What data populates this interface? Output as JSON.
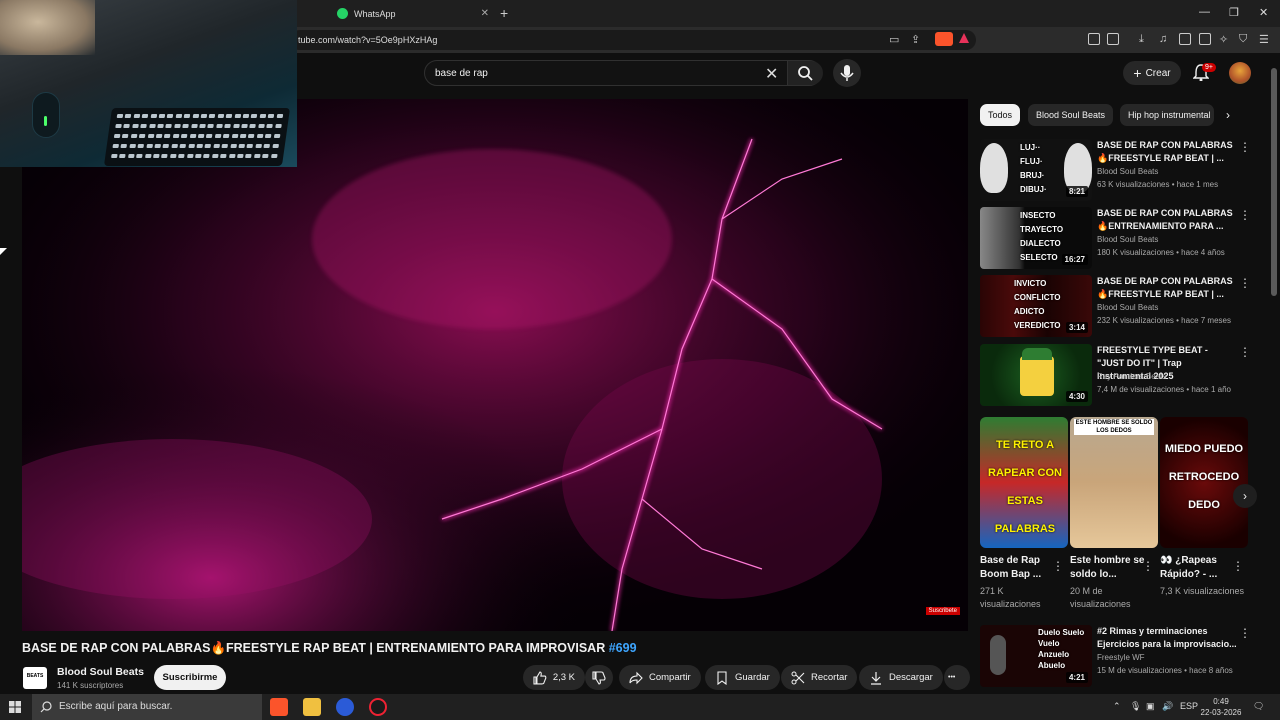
{
  "browser": {
    "tab_label": "WhatsApp",
    "url": "tube.com/watch?v=5Oe9pHXzHAg",
    "new_tab": "+"
  },
  "header": {
    "search_value": "base de rap",
    "create_label": "Crear",
    "notifications_badge": "9+"
  },
  "video": {
    "title_text": "BASE DE RAP CON PALABRAS🔥FREESTYLE RAP BEAT | ENTRENAMIENTO PARA IMPROVISAR ",
    "title_tag": "#699",
    "watermark": "Suscribete"
  },
  "channel": {
    "name": "Blood Soul Beats",
    "subscribers": "141 K suscriptores",
    "logo_text": "BEATS",
    "subscribe_label": "Suscribirme"
  },
  "actions": {
    "likes": "2,3 K",
    "share": "Compartir",
    "save": "Guardar",
    "clip": "Recortar",
    "download": "Descargar",
    "more": "•••"
  },
  "chips": [
    "Todos",
    "Blood Soul Beats",
    "Hip hop instrumental"
  ],
  "recommendations": [
    {
      "title": "BASE DE RAP CON PALABRAS 🔥FREESTYLE RAP BEAT | ...",
      "channel": "Blood Soul Beats",
      "meta": "63 K visualizaciones • hace 1 mes",
      "duration": "8:21",
      "thumb_words": "LUJ·· FLUJ· BRUJ· DIBUJ·"
    },
    {
      "title": "BASE DE RAP CON PALABRAS 🔥ENTRENAMIENTO PARA ...",
      "channel": "Blood Soul Beats",
      "meta": "180 K visualizaciones • hace 4 años",
      "duration": "16:27",
      "thumb_words": "INSECTO TRAYECTO DIALECTO SELECTO"
    },
    {
      "title": "BASE DE RAP CON PALABRAS 🔥FREESTYLE RAP BEAT | ...",
      "channel": "Blood Soul Beats",
      "meta": "232 K visualizaciones • hace 7 meses",
      "duration": "3:14",
      "thumb_words": "INVICTO CONFLICTO ADICTO VEREDICTO"
    },
    {
      "title": "FREESTYLE TYPE BEAT - \"JUST DO IT\" | Trap Instrumental 2025",
      "channel": "Rey Pandora Beats",
      "meta": "7,4 M de visualizaciones • hace 1 año",
      "duration": "4:30",
      "thumb_words": ""
    }
  ],
  "shorts": [
    {
      "title": "Base de Rap Boom Bap ...",
      "views": "271 K visualizaciones",
      "thumb_words": "TE RETO A RAPEAR CON ESTAS PALABRAS"
    },
    {
      "title": "Este hombre se soldo lo...",
      "views": "20 M de visualizaciones",
      "thumb_words": "ESTE HOMBRE SE SOLDO LOS DEDOS"
    },
    {
      "title": "👀 ¿Rapeas Rápido? - ...",
      "views": "7,3 K visualizaciones",
      "thumb_words": "MIEDO PUEDO RETROCEDO DEDO"
    }
  ],
  "last_rec": {
    "title": "#2 Rimas y terminaciones Ejercicios para la improvisacio...",
    "channel": "Freestyle WF",
    "meta": "15 M de visualizaciones • hace 8 años",
    "duration": "4:21",
    "thumb_words": "Duelo Suelo Vuelo Anzuelo Abuelo"
  },
  "taskbar": {
    "search_placeholder": "Escribe aquí para buscar.",
    "lang": "ESP",
    "time": "0:49",
    "date": "22-03-2026"
  },
  "colors": {
    "accent_blue": "#3ea6ff",
    "lightning": "#ff1aa8",
    "brave": "#fb542b"
  }
}
